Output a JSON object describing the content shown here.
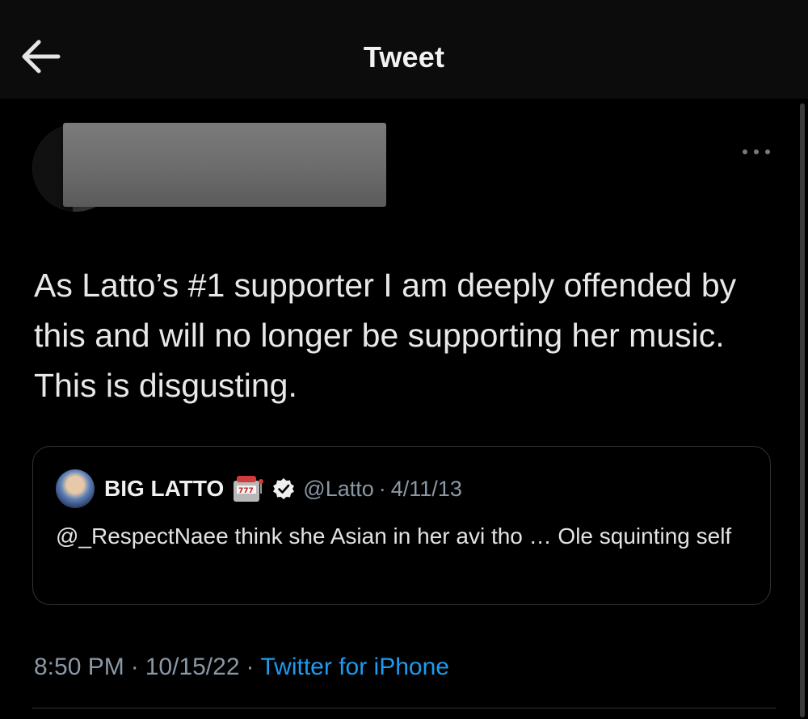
{
  "header": {
    "title": "Tweet",
    "back_icon": "arrow-left-icon"
  },
  "tweet": {
    "author_name": "",
    "more_icon": "more-horizontal-icon",
    "text": "As Latto’s #1 supporter I am deeply offended by this and will no longer be supporting her music. This is disgusting.",
    "time": "8:50 PM",
    "separator": "·",
    "date": "10/15/22",
    "source": "Twitter for iPhone"
  },
  "quoted_tweet": {
    "name": "BIG LATTO",
    "badge_icon": "slot-machine-icon",
    "verified_icon": "verified-badge-icon",
    "handle": "@Latto",
    "separator": "·",
    "date": "4/11/13",
    "text": "@_RespectNaee think she Asian in her avi tho … Ole squinting self"
  },
  "colors": {
    "background": "#000000",
    "header_background": "#0c0c0c",
    "text_primary": "#e7e9ea",
    "text_secondary": "#8b98a5",
    "link": "#1d9bf0",
    "border": "#2f3336",
    "redaction": "#6e6e6e"
  }
}
